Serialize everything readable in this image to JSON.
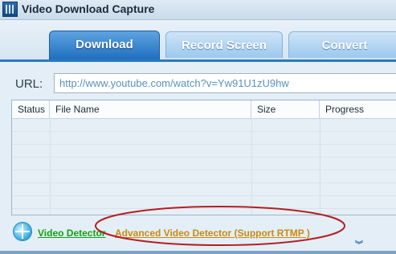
{
  "window": {
    "title": "Video Download Capture",
    "icon": "film-icon"
  },
  "tabs": [
    {
      "label": "Download",
      "active": true
    },
    {
      "label": "Record Screen",
      "active": false
    },
    {
      "label": "Convert",
      "active": false
    }
  ],
  "url": {
    "label": "URL:",
    "value": "http://www.youtube.com/watch?v=Yw91U1zU9hw"
  },
  "table": {
    "columns": [
      "Status",
      "File Name",
      "Size",
      "Progress"
    ],
    "rows": []
  },
  "footer": {
    "detector_link": "Video Detector",
    "advanced_link": "Advanced Video Detector (Support RTMP )",
    "expand_icon": "double-chevron-down-icon"
  },
  "colors": {
    "accent": "#2a79c2",
    "detector_link": "#0fa30f",
    "advanced_link": "#c98a12",
    "highlight": "#b32020"
  }
}
